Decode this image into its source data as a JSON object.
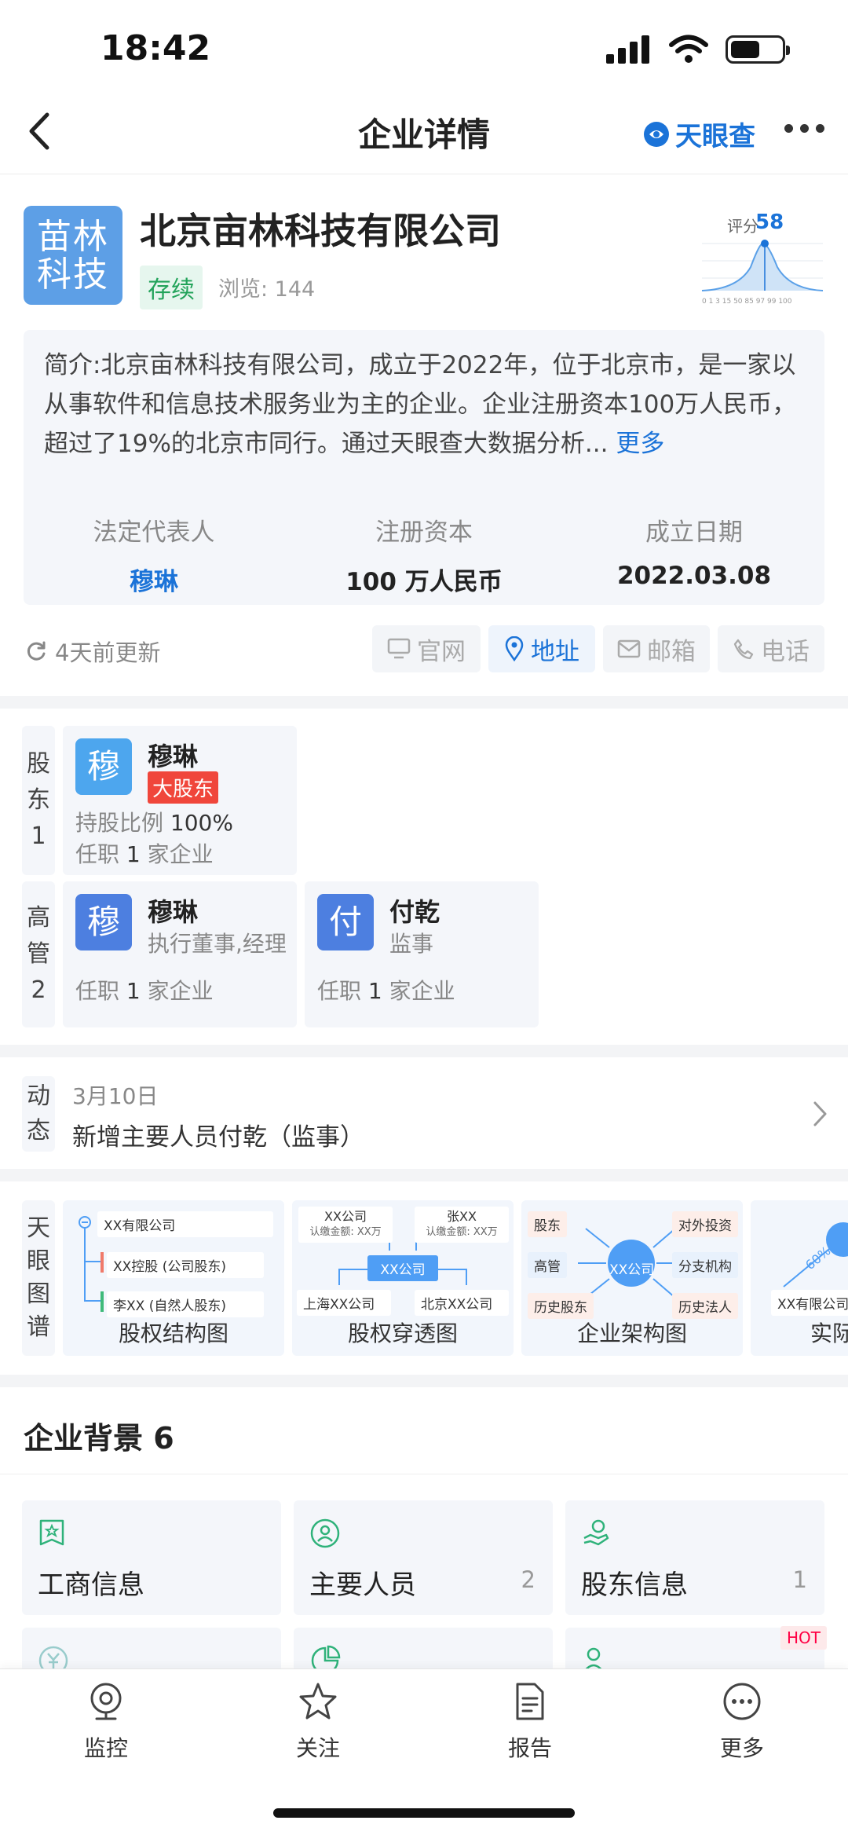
{
  "status": {
    "time": "18:42"
  },
  "nav": {
    "title": "企业详情",
    "brand": "天眼查"
  },
  "company": {
    "logo_text": "苗林科技",
    "name": "北京亩林科技有限公司",
    "status": "存续",
    "views_label": "浏览: 144",
    "score_label": "评分",
    "score_value": "58",
    "score_ticks": "0 1 3 15 50 85 97 99 100"
  },
  "intro": {
    "text": "简介:北京亩林科技有限公司，成立于2022年，位于北京市，是一家以从事软件和信息技术服务业为主的企业。企业注册资本100万人民币，超过了19%的北京市同行。通过天眼查大数据分析...",
    "more": "更多",
    "legal_rep_label": "法定代表人",
    "legal_rep": "穆琳",
    "capital_label": "注册资本",
    "capital": "100 万人民币",
    "founded_label": "成立日期",
    "founded": "2022.03.08"
  },
  "update": {
    "text": "4天前更新",
    "chips": [
      "官网",
      "地址",
      "邮箱",
      "电话"
    ]
  },
  "shareholders": {
    "label": "股东1",
    "label_chars": [
      "股",
      "东",
      "1"
    ],
    "items": [
      {
        "avatar": "穆",
        "name": "穆琳",
        "tag": "大股东",
        "ratio_label": "持股比例",
        "ratio": "100%",
        "job_prefix": "任职",
        "job_count": "1",
        "job_suffix": "家企业"
      }
    ]
  },
  "executives": {
    "label_chars": [
      "高",
      "管",
      "2"
    ],
    "items": [
      {
        "avatar": "穆",
        "name": "穆琳",
        "role": "执行董事,经理",
        "job_prefix": "任职",
        "job_count": "1",
        "job_suffix": "家企业"
      },
      {
        "avatar": "付",
        "name": "付乾",
        "role": "监事",
        "job_prefix": "任职",
        "job_count": "1",
        "job_suffix": "家企业"
      }
    ]
  },
  "activity": {
    "label_chars": [
      "动",
      "态"
    ],
    "date": "3月10日",
    "text": "新增主要人员付乾（监事）"
  },
  "graphs": {
    "label_chars": [
      "天",
      "眼",
      "图",
      "谱"
    ],
    "items": [
      {
        "title": "股权结构图",
        "nodes": [
          "XX有限公司",
          "XX控股 (公司股东)",
          "李XX (自然人股东)"
        ]
      },
      {
        "title": "股权穿透图",
        "nodes": [
          "XX公司",
          "认缴金额: XX万",
          "张XX",
          "认缴金额: XX万",
          "XX公司",
          "上海XX公司",
          "北京XX公司"
        ]
      },
      {
        "title": "企业架构图",
        "nodes": [
          "股东",
          "对外投资",
          "高管",
          "XX公司",
          "分支机构",
          "历史股东",
          "历史法人"
        ]
      },
      {
        "title": "实际",
        "nodes": [
          "XX有限公司",
          "60%"
        ]
      }
    ]
  },
  "background": {
    "title": "企业背景 6",
    "items": [
      {
        "label": "工商信息",
        "count": ""
      },
      {
        "label": "主要人员",
        "count": "2"
      },
      {
        "label": "股东信息",
        "count": "1"
      }
    ],
    "hot": "HOT"
  },
  "tabs": [
    "监控",
    "关注",
    "报告",
    "更多"
  ]
}
